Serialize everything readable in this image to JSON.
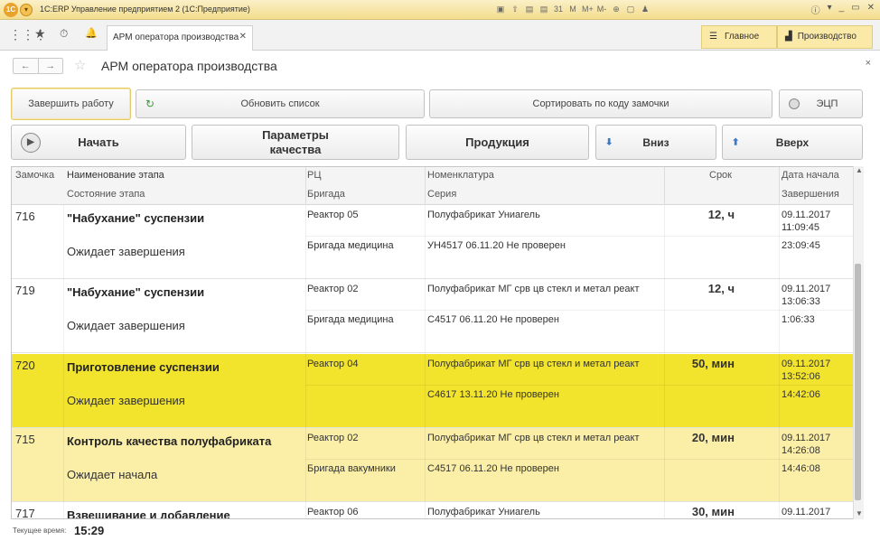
{
  "titlebar": {
    "logo": "1С",
    "title": "1С:ERP Управление предприятием 2 (1С:Предприятие)",
    "icons": [
      "▣",
      "⇧",
      "▤",
      "▤",
      "31"
    ],
    "extra": [
      "M",
      "M+",
      "M-",
      "⊕",
      "▢",
      "♟"
    ],
    "controls": [
      "ⓘ",
      "▾",
      "_",
      "▭",
      "✕"
    ]
  },
  "nav": {
    "apps": "⋮⋮⋮",
    "star": "★",
    "history": "⏱",
    "bell": "🔔",
    "tab_label": "АРМ оператора производства",
    "tab_close": "✕",
    "main_label": "Главное",
    "production_label": "Производство"
  },
  "header": {
    "back": "←",
    "forward": "→",
    "star": "☆",
    "title": "АРМ оператора производства",
    "close": "×"
  },
  "buttons": {
    "finish_work": "Завершить работу",
    "refresh": "Обновить список",
    "sort": "Сортировать по коду замочки",
    "ecp": "ЭЦП",
    "start": "Начать",
    "quality_params": "Параметры качества",
    "products": "Продукция",
    "down": "Вниз",
    "up": "Вверх"
  },
  "columns": {
    "code": "Замочка",
    "stage": "Наименование этапа",
    "stage_state": "Состояние этапа",
    "rc": "РЦ",
    "brigade": "Бригада",
    "nomenclature": "Номенклатура",
    "series": "Серия",
    "term": "Срок",
    "start_date": "Дата начала",
    "end": "Завершения"
  },
  "rows": [
    {
      "code": "716",
      "stage": "\"Набухание\" суспензии",
      "state": "Ожидает завершения",
      "rc": "Реактор 05",
      "brigade": "Бригада медицина",
      "nomenclature": "Полуфабрикат Униагель",
      "series": "УН4517 06.11.20 Не проверен",
      "term": "12, ч",
      "start": "09.11.2017 11:09:45",
      "end": "23:09:45",
      "highlight": "none"
    },
    {
      "code": "719",
      "stage": "\"Набухание\" суспензии",
      "state": "Ожидает завершения",
      "rc": "Реактор 02",
      "brigade": "Бригада медицина",
      "nomenclature": "Полуфабрикат МГ срв цв стекл и метал реакт",
      "series": "С4517 06.11.20 Не проверен",
      "term": "12, ч",
      "start": "09.11.2017 13:06:33",
      "end": "1:06:33",
      "highlight": "none"
    },
    {
      "code": "720",
      "stage": "Приготовление суспензии",
      "state": "Ожидает завершения",
      "rc": "Реактор 04",
      "brigade": "",
      "nomenclature": "Полуфабрикат МГ срв цв стекл и метал реакт",
      "series": "С4617 13.11.20 Не проверен",
      "term": "50, мин",
      "start": "09.11.2017 13:52:06",
      "end": "14:42:06",
      "highlight": "#f2e32c"
    },
    {
      "code": "715",
      "stage": "Контроль качества полуфабриката",
      "state": "Ожидает начала",
      "rc": "Реактор 02",
      "brigade": "Бригада вакумники",
      "nomenclature": "Полуфабрикат МГ срв цв стекл и метал реакт",
      "series": "С4517 06.11.20 Не проверен",
      "term": "20, мин",
      "start": "09.11.2017 14:26:08",
      "end": "14:46:08",
      "highlight": "#fbefa8"
    },
    {
      "code": "717",
      "stage": "Взвешивание и добавление",
      "state": "",
      "rc": "Реактор 06",
      "brigade": "",
      "nomenclature": "Полуфабрикат Униагель",
      "series": "",
      "term": "30, мин",
      "start": "09.11.2017",
      "end": "",
      "highlight": "none"
    }
  ],
  "footer": {
    "label": "Текущее время:",
    "time": "15:29"
  },
  "colors": {
    "selected_row": "#f2e32c",
    "alt_row": "#fbefa8",
    "accent": "#f3dd8c"
  }
}
